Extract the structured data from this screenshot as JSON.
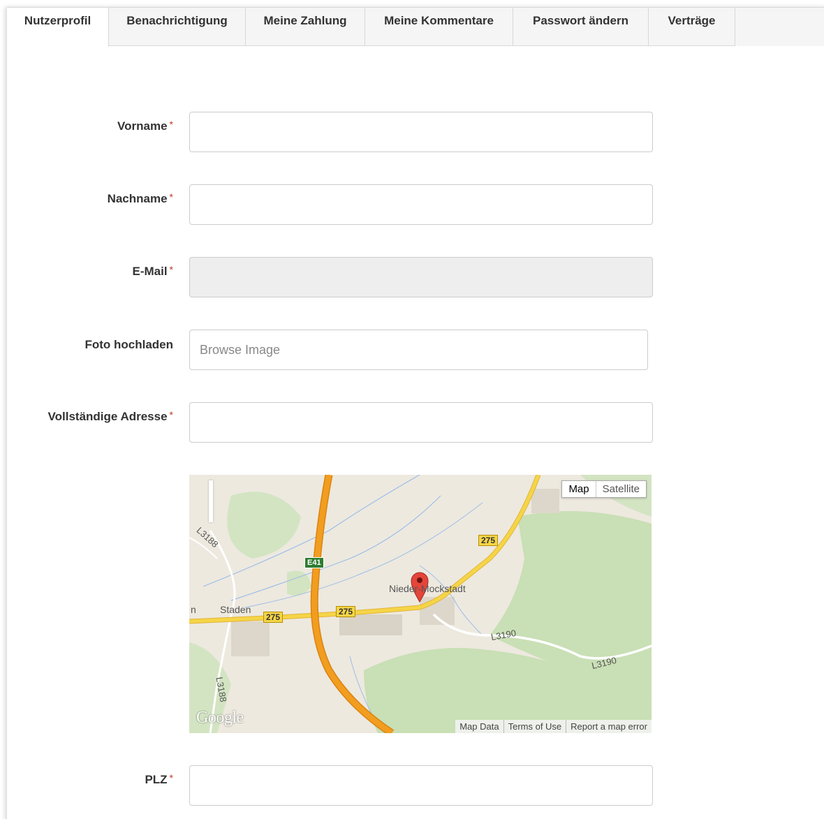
{
  "tabs": [
    {
      "label": "Nutzerprofil",
      "active": true
    },
    {
      "label": "Benachrichtigung",
      "active": false
    },
    {
      "label": "Meine Zahlung",
      "active": false
    },
    {
      "label": "Meine Kommentare",
      "active": false
    },
    {
      "label": "Passwort ändern",
      "active": false
    },
    {
      "label": "Verträge",
      "active": false
    }
  ],
  "form": {
    "required_marker": "*",
    "firstname": {
      "label": "Vorname",
      "value": ""
    },
    "lastname": {
      "label": "Nachname",
      "value": ""
    },
    "email": {
      "label": "E-Mail",
      "value": "",
      "disabled": true
    },
    "photo": {
      "label": "Foto hochladen",
      "placeholder": "Browse Image"
    },
    "address": {
      "label": "Vollständige Adresse",
      "value": ""
    },
    "zip": {
      "label": "PLZ",
      "value": ""
    }
  },
  "map": {
    "type_buttons": {
      "map": "Map",
      "satellite": "Satellite"
    },
    "logo": "Google",
    "footer": {
      "data": "Map Data",
      "terms": "Terms of Use",
      "report": "Report a map error"
    },
    "places": {
      "town": "Nieder-Mockstadt",
      "staden": "Staden",
      "n": "n"
    },
    "roads": {
      "r275": "275",
      "e41": "E41",
      "l3188": "L3188",
      "l3190": "L3190"
    }
  },
  "colors": {
    "required": "#c0392b",
    "tab_inactive": "#f5f5f5",
    "motorway": "#f29d1f",
    "road": "#f5d547",
    "forest": "#c9dfb5"
  }
}
